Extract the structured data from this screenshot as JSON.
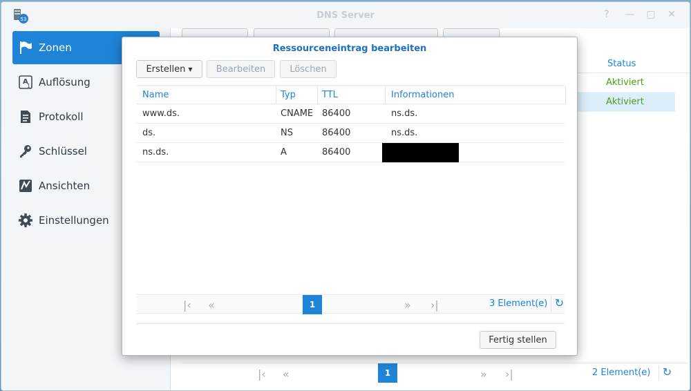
{
  "window": {
    "title": "DNS Server",
    "controls": [
      "help-icon",
      "minimize-icon",
      "maximize-icon",
      "close-icon"
    ]
  },
  "sidebar": {
    "items": [
      {
        "label": "Zonen",
        "icon": "flag-icon",
        "active": true
      },
      {
        "label": "Auflösung",
        "icon": "resolution-icon",
        "active": false
      },
      {
        "label": "Protokoll",
        "icon": "log-icon",
        "active": false
      },
      {
        "label": "Schlüssel",
        "icon": "key-icon",
        "active": false
      },
      {
        "label": "Ansichten",
        "icon": "views-icon",
        "active": false
      },
      {
        "label": "Einstellungen",
        "icon": "gear-icon",
        "active": false
      }
    ]
  },
  "background": {
    "status_header": "Status",
    "rows": [
      {
        "status": "Aktiviert",
        "selected": false
      },
      {
        "status": "Aktiviert",
        "selected": true
      }
    ],
    "pager": {
      "page": "1",
      "count": "2 Element(e)"
    }
  },
  "dialog": {
    "title": "Ressourceneintrag bearbeiten",
    "toolbar": {
      "create": "Erstellen",
      "edit": "Bearbeiten",
      "delete": "Löschen"
    },
    "columns": [
      "Name",
      "Typ",
      "TTL",
      "Informationen"
    ],
    "rows": [
      {
        "name": "www.ds.",
        "type": "CNAME",
        "ttl": "86400",
        "info": "ns.ds."
      },
      {
        "name": "ds.",
        "type": "NS",
        "ttl": "86400",
        "info": "ns.ds."
      },
      {
        "name": "ns.ds.",
        "type": "A",
        "ttl": "86400",
        "info": ""
      }
    ],
    "pager": {
      "page": "1",
      "count": "3 Element(e)"
    },
    "finish_button": "Fertig stellen"
  },
  "colors": {
    "accent": "#1d84d8",
    "status_green": "#4b9d1c",
    "title_blue": "#1d6fbf"
  }
}
